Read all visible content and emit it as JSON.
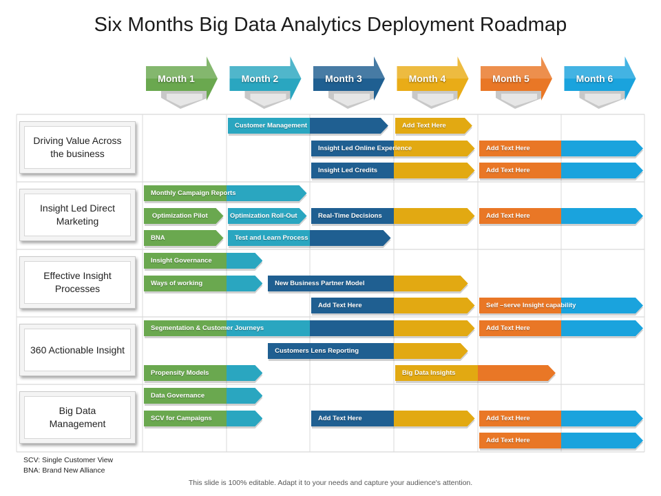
{
  "title": "Six Months Big Data Analytics Deployment Roadmap",
  "months": [
    "Month 1",
    "Month 2",
    "Month 3",
    "Month 4",
    "Month 5",
    "Month 6"
  ],
  "colors": {
    "month1": "#6aa84f",
    "month2": "#2aa6c0",
    "month3": "#1f5f91",
    "month4": "#e9ac17",
    "month5": "#e97726",
    "month6": "#1aa3dd",
    "green": "#6aa84f",
    "teal": "#2aa6c0",
    "navy": "#1f5f91",
    "yellow": "#e2a912",
    "orange": "#e97726",
    "blue": "#1aa3dd"
  },
  "rows": [
    {
      "label": "Driving Value Across the business"
    },
    {
      "label": "Insight Led Direct Marketing"
    },
    {
      "label": "Effective Insight Processes"
    },
    {
      "label": "360 Actionable Insight"
    },
    {
      "label": "Big Data Management"
    }
  ],
  "bars": [
    {
      "row": 0,
      "line": 0,
      "start": 2,
      "end": 3.95,
      "label": "Customer Management",
      "segments": [
        "teal",
        "navy"
      ]
    },
    {
      "row": 0,
      "line": 0,
      "start": 4,
      "end": 4.95,
      "label": "Add Text Here",
      "segments": [
        "yellow"
      ]
    },
    {
      "row": 0,
      "line": 1,
      "start": 3,
      "end": 4.98,
      "label": "Insight Led Online Experience",
      "segments": [
        "navy",
        "yellow"
      ]
    },
    {
      "row": 0,
      "line": 1,
      "start": 5,
      "end": 7,
      "label": "Add Text Here",
      "segments": [
        "orange",
        "blue"
      ]
    },
    {
      "row": 0,
      "line": 2,
      "start": 3,
      "end": 4.98,
      "label": "Insight Led Credits",
      "segments": [
        "navy",
        "yellow"
      ]
    },
    {
      "row": 0,
      "line": 2,
      "start": 5,
      "end": 7,
      "label": "Add Text Here",
      "segments": [
        "orange",
        "blue"
      ]
    },
    {
      "row": 1,
      "line": 0,
      "start": 1,
      "end": 2.98,
      "label": "Monthly Campaign Reports",
      "segments": [
        "green",
        "teal"
      ]
    },
    {
      "row": 1,
      "line": 1,
      "start": 1,
      "end": 1.98,
      "label": "Optimization Pilot",
      "segments": [
        "green"
      ],
      "center": true
    },
    {
      "row": 1,
      "line": 1,
      "start": 2,
      "end": 2.98,
      "label": "Optimization Roll-Out",
      "segments": [
        "teal"
      ],
      "center": true
    },
    {
      "row": 1,
      "line": 1,
      "start": 3,
      "end": 4.98,
      "label": "Real-Time Decisions",
      "segments": [
        "navy",
        "yellow"
      ]
    },
    {
      "row": 1,
      "line": 1,
      "start": 5,
      "end": 7,
      "label": "Add Text Here",
      "segments": [
        "orange",
        "blue"
      ]
    },
    {
      "row": 1,
      "line": 2,
      "start": 1,
      "end": 1.98,
      "label": "BNA",
      "segments": [
        "green"
      ]
    },
    {
      "row": 1,
      "line": 2,
      "start": 2,
      "end": 3.98,
      "label": "Test and Learn Process",
      "segments": [
        "teal",
        "navy"
      ]
    },
    {
      "row": 2,
      "line": 0,
      "start": 1,
      "end": 2.45,
      "label": "Insight Governance",
      "segments": [
        "green",
        "teal"
      ]
    },
    {
      "row": 2,
      "line": 1,
      "start": 1,
      "end": 2.45,
      "label": "Ways of working",
      "segments": [
        "green",
        "teal"
      ]
    },
    {
      "row": 2,
      "line": 1,
      "start": 2.48,
      "end": 4.9,
      "label": "New Business Partner Model",
      "segments": [
        "navy",
        "yellow"
      ],
      "split": 4
    },
    {
      "row": 2,
      "line": 2,
      "start": 3,
      "end": 4.98,
      "label": "Add Text Here",
      "segments": [
        "navy",
        "yellow"
      ]
    },
    {
      "row": 2,
      "line": 2,
      "start": 5,
      "end": 7,
      "label": "Self –serve Insight capability",
      "segments": [
        "orange",
        "blue"
      ]
    },
    {
      "row": 3,
      "line": 0,
      "start": 1,
      "end": 4.98,
      "label": "Segmentation & Customer Journeys",
      "segments": [
        "green",
        "teal",
        "navy",
        "yellow"
      ]
    },
    {
      "row": 3,
      "line": 0,
      "start": 5,
      "end": 7,
      "label": "Add Text Here",
      "segments": [
        "orange",
        "blue"
      ]
    },
    {
      "row": 3,
      "line": 1,
      "start": 2.48,
      "end": 4.9,
      "label": "Customers Lens Reporting",
      "segments": [
        "navy",
        "yellow"
      ],
      "split": 4
    },
    {
      "row": 3,
      "line": 2,
      "start": 1,
      "end": 2.45,
      "label": "Propensity Models",
      "segments": [
        "green",
        "teal"
      ]
    },
    {
      "row": 3,
      "line": 2,
      "start": 4,
      "end": 5.95,
      "label": "Big Data Insights",
      "segments": [
        "yellow",
        "orange"
      ]
    },
    {
      "row": 4,
      "line": 0,
      "start": 1,
      "end": 2.45,
      "label": "Data Governance",
      "segments": [
        "green",
        "teal"
      ]
    },
    {
      "row": 4,
      "line": 1,
      "start": 1,
      "end": 2.45,
      "label": "SCV for Campaigns",
      "segments": [
        "green",
        "teal"
      ]
    },
    {
      "row": 4,
      "line": 1,
      "start": 3,
      "end": 4.98,
      "label": "Add Text Here",
      "segments": [
        "navy",
        "yellow"
      ]
    },
    {
      "row": 4,
      "line": 1,
      "start": 5,
      "end": 7,
      "label": "Add Text Here",
      "segments": [
        "orange",
        "blue"
      ]
    },
    {
      "row": 4,
      "line": 2,
      "start": 5,
      "end": 7,
      "label": "Add Text Here",
      "segments": [
        "orange",
        "blue"
      ]
    }
  ],
  "legend": [
    "SCV: Single Customer View",
    "BNA: Brand New Alliance"
  ],
  "footer": "This slide is 100% editable. Adapt it to your needs and capture your audience's attention."
}
